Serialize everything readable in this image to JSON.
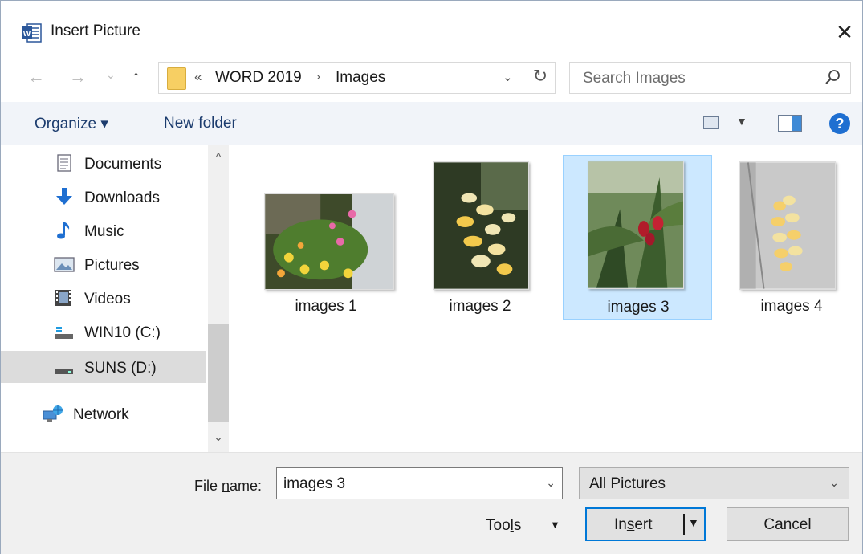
{
  "window": {
    "title": "Insert Picture",
    "close_glyph": "✕",
    "app_icon": "word-icon"
  },
  "navigation": {
    "back_glyph": "←",
    "forward_glyph": "→",
    "recent_glyph": "⌄",
    "up_glyph": "↑",
    "breadcrumb_overflow": "«",
    "breadcrumb": [
      "WORD 2019",
      "Images"
    ],
    "breadcrumb_sep_glyph": "›",
    "dropdown_glyph": "⌄",
    "refresh_glyph": "↻",
    "search_placeholder": "Search Images"
  },
  "toolbar": {
    "organize_label": "Organize ▾",
    "new_folder_label": "New folder",
    "view_drop_glyph": "▼",
    "help_glyph": "?"
  },
  "sidebar": {
    "items": [
      {
        "label": "Documents",
        "icon": "documents-icon"
      },
      {
        "label": "Downloads",
        "icon": "downloads-icon"
      },
      {
        "label": "Music",
        "icon": "music-icon"
      },
      {
        "label": "Pictures",
        "icon": "pictures-icon"
      },
      {
        "label": "Videos",
        "icon": "videos-icon"
      },
      {
        "label": "WIN10 (C:)",
        "icon": "drive-c-icon"
      },
      {
        "label": "SUNS (D:)",
        "icon": "drive-d-icon",
        "selected": true
      },
      {
        "label": "Network",
        "icon": "network-icon"
      }
    ],
    "scroll_up_glyph": "^",
    "scroll_down_glyph": "⌄"
  },
  "files": [
    {
      "name": "images 1",
      "selected": false
    },
    {
      "name": "images 2",
      "selected": false
    },
    {
      "name": "images 3",
      "selected": true
    },
    {
      "name": "images 4",
      "selected": false
    }
  ],
  "footer": {
    "file_name_label_prefix": "File ",
    "file_name_label_accel": "n",
    "file_name_label_suffix": "ame:",
    "file_name_value": "images 3",
    "file_type_value": "All Pictures",
    "tools_label_prefix": "Too",
    "tools_label_accel": "l",
    "tools_label_suffix": "s",
    "tools_drop_glyph": "▼",
    "insert_label_prefix": "In",
    "insert_label_accel": "s",
    "insert_label_suffix": "ert",
    "insert_drop_glyph": "▼",
    "cancel_label": "Cancel",
    "dropdown_glyph": "⌄"
  },
  "colors": {
    "accent": "#0078d7",
    "selection_bg": "#cce8ff",
    "toolbar_bg": "#f1f4f9",
    "footer_bg": "#f0f0f0"
  }
}
